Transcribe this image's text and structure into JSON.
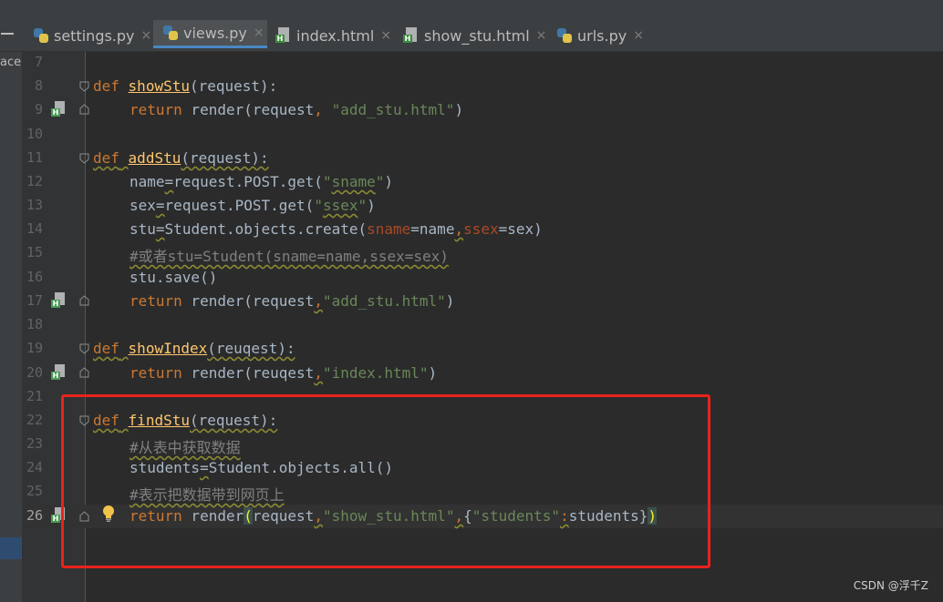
{
  "tabs": [
    {
      "label": "settings.py",
      "type": "python",
      "active": false
    },
    {
      "label": "views.py",
      "type": "python",
      "active": true
    },
    {
      "label": "index.html",
      "type": "html",
      "active": false
    },
    {
      "label": "show_stu.html",
      "type": "html",
      "active": false
    },
    {
      "label": "urls.py",
      "type": "python",
      "active": false
    }
  ],
  "close_glyph": "×",
  "left_panel_text": "ace",
  "current_line": 26,
  "line_numbers": [
    "7",
    "8",
    "9",
    "10",
    "11",
    "12",
    "13",
    "14",
    "15",
    "16",
    "17",
    "18",
    "19",
    "20",
    "21",
    "22",
    "23",
    "24",
    "25",
    "26"
  ],
  "code": {
    "l8_def": "def",
    "l8_name": "showStu",
    "l8_rest": "(request):",
    "l9_ret": "return",
    "l9_a": " render(request",
    "l9_comma": ",",
    "l9_str": " \"add_stu.html\"",
    "l9_end": ")",
    "l11_def": "def",
    "l11_name": "addStu",
    "l11_rest": "(request):",
    "l12_a": "name",
    "l12_eq": "=",
    "l12_b": "request.POST.get(",
    "l12_q1": "\"",
    "l12_s": "sname",
    "l12_q2": "\"",
    "l12_end": ")",
    "l13_a": "sex",
    "l13_eq": "=",
    "l13_b": "request.POST.get(",
    "l13_q1": "\"",
    "l13_s": "ssex",
    "l13_q2": "\"",
    "l13_end": ")",
    "l14_a": "stu",
    "l14_eq": "=",
    "l14_b": "Student.objects.create(",
    "l14_p1": "sname",
    "l14_c": "=name",
    "l14_comma": ",",
    "l14_p2": "ssex",
    "l14_d": "=sex)",
    "l15_cmt": "#或者stu=Student(sname=name,ssex=sex)",
    "l16": "stu.save()",
    "l17_ret": "return",
    "l17_a": " render(request",
    "l17_comma": ",",
    "l17_str": "\"add_stu.html\"",
    "l17_end": ")",
    "l19_def": "def",
    "l19_name": "showIndex",
    "l19_rest": "(reuqest):",
    "l20_ret": "return",
    "l20_a": " render(reuqest",
    "l20_comma": ",",
    "l20_str": "\"index.html\"",
    "l20_end": ")",
    "l22_def": "def",
    "l22_name": "findStu",
    "l22_rest": "(request):",
    "l23_cmt": "#从表中获取数据",
    "l24_a": "students",
    "l24_eq": "=",
    "l24_b": "Student.objects.all()",
    "l25_cmt": "#表示把数据带到网页上",
    "l26_ret": "return",
    "l26_a": " render",
    "l26_p": "(",
    "l26_b": "request",
    "l26_comma1": ",",
    "l26_str": "\"show_stu.html\"",
    "l26_comma2": ",",
    "l26_brace1": "{",
    "l26_key": "\"students\"",
    "l26_colon": ":",
    "l26_val": "students",
    "l26_brace2": "}",
    "l26_pend": ")"
  },
  "watermark": "CSDN @浮千Z",
  "colors": {
    "keyword": "#cc7832",
    "function": "#ffc66d",
    "string": "#6a8759",
    "param": "#aa4926",
    "comment": "#808080",
    "highlight_box": "#e8231b"
  }
}
